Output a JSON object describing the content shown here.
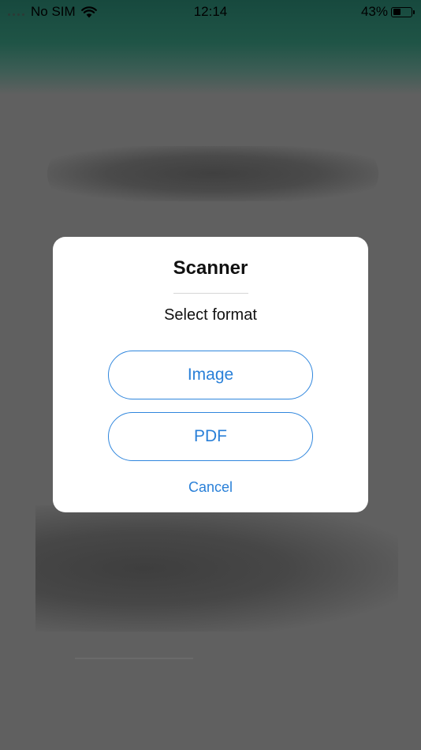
{
  "status_bar": {
    "carrier": "No SIM",
    "time": "12:14",
    "battery_percent": "43%",
    "battery_level": 0.43,
    "wifi_icon": "wifi-icon",
    "battery_icon": "battery-icon"
  },
  "dialog": {
    "title": "Scanner",
    "subtitle": "Select format",
    "buttons": [
      {
        "label": "Image"
      },
      {
        "label": "PDF"
      }
    ],
    "cancel_label": "Cancel"
  },
  "colors": {
    "accent": "#2a80d8",
    "header_green": "#1f5446",
    "overlay": "#606060"
  }
}
